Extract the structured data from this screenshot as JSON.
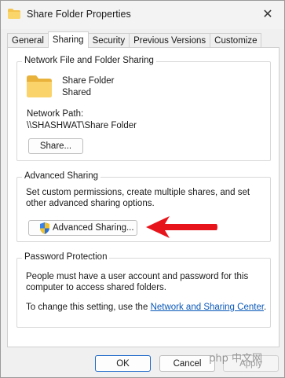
{
  "window": {
    "title": "Share Folder Properties",
    "close_glyph": "✕"
  },
  "tabs": [
    {
      "label": "General",
      "active": false
    },
    {
      "label": "Sharing",
      "active": true
    },
    {
      "label": "Security",
      "active": false
    },
    {
      "label": "Previous Versions",
      "active": false
    },
    {
      "label": "Customize",
      "active": false
    }
  ],
  "network_sharing": {
    "group_label": "Network File and Folder Sharing",
    "folder_name": "Share Folder",
    "status": "Shared",
    "path_label": "Network Path:",
    "path_value": "\\\\SHASHWAT\\Share Folder",
    "share_button": "Share..."
  },
  "advanced_sharing": {
    "group_label": "Advanced Sharing",
    "description": "Set custom permissions, create multiple shares, and set other advanced sharing options.",
    "button": "Advanced Sharing..."
  },
  "password_protection": {
    "group_label": "Password Protection",
    "description": "People must have a user account and password for this computer to access shared folders.",
    "change_prefix": "To change this setting, use the",
    "link": "Network and Sharing Center",
    "change_suffix": "."
  },
  "footer": {
    "ok": "OK",
    "cancel": "Cancel",
    "apply": "Apply"
  },
  "watermark": "php 中文网",
  "colors": {
    "arrow": "#e8141b",
    "link": "#0a58b8",
    "folder": "#f4c44e",
    "focus": "#1a66c9"
  }
}
